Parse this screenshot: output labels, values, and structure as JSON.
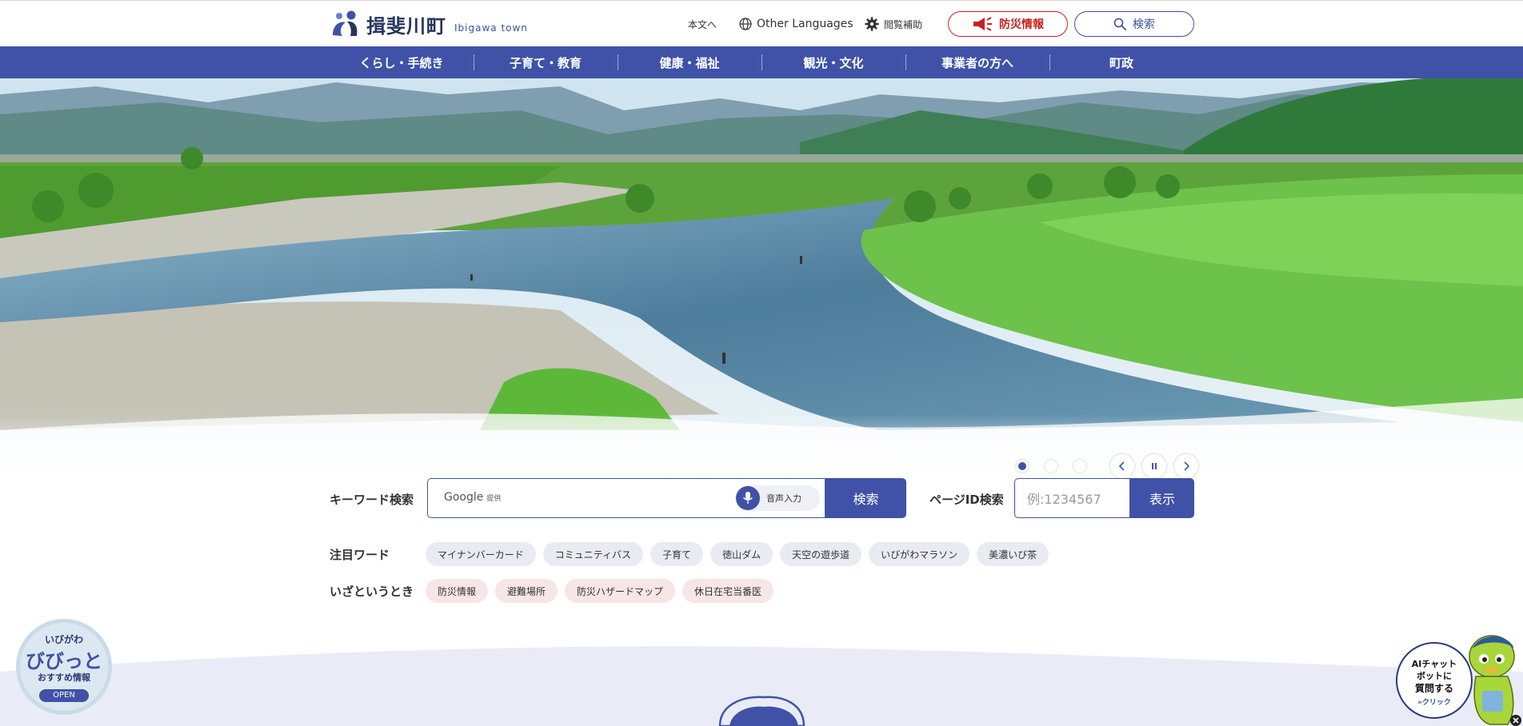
{
  "header": {
    "logo_title": "揖斐川町",
    "logo_sub": "Ibigawa town",
    "skip_link": "本文へ",
    "languages": "Other Languages",
    "accessibility": "閲覧補助",
    "bosai_button": "防災情報",
    "search_button": "検索"
  },
  "nav": {
    "items": [
      "くらし・手続き",
      "子育て・教育",
      "健康・福祉",
      "観光・文化",
      "事業者の方へ",
      "町政"
    ]
  },
  "slider": {
    "slide_count": 3,
    "active_index": 0
  },
  "search": {
    "keyword_label": "キーワード検索",
    "google_text": "Google",
    "google_sub": "提供",
    "voice_label": "音声入力",
    "submit_label": "検索",
    "page_id_label": "ページID検索",
    "page_id_placeholder": "例:1234567",
    "page_id_submit": "表示"
  },
  "featured": {
    "label": "注目ワード",
    "tags": [
      "マイナンバーカード",
      "コミュニティバス",
      "子育て",
      "徳山ダム",
      "天空の遊歩道",
      "いびがわマラソン",
      "美濃いび茶"
    ]
  },
  "emergency": {
    "label": "いざというとき",
    "tags": [
      "防災情報",
      "避難場所",
      "防災ハザードマップ",
      "休日在宅当番医"
    ]
  },
  "biby": {
    "line1": "いびがわ",
    "line2": "びびっと",
    "line3": "おすすめ情報",
    "open": "OPEN"
  },
  "ai_chat": {
    "line1": "AIチャット",
    "line2": "ボットに",
    "line3": "質問する",
    "line4": "»クリック"
  },
  "colors": {
    "brand": "#3f52a7",
    "alert": "#c8211e"
  }
}
